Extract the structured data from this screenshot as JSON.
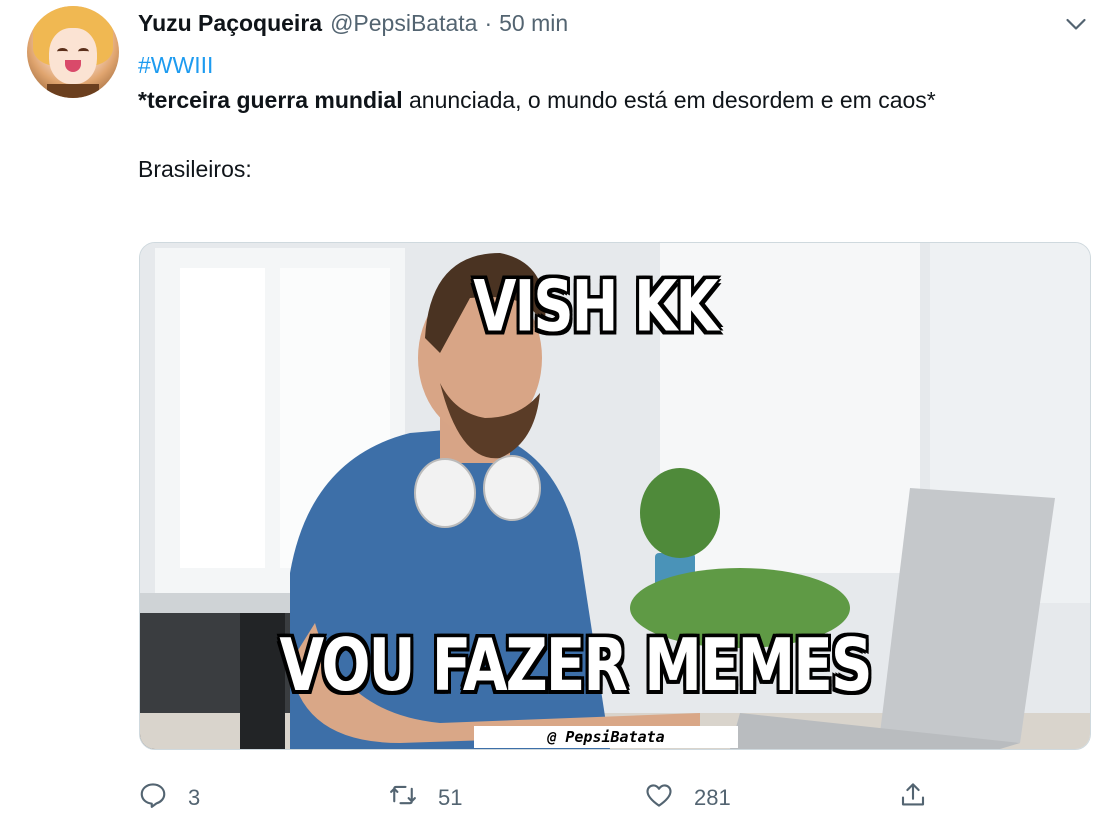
{
  "tweet": {
    "author_name": "Yuzu Paçoqueira",
    "handle": "@PepsiBatata",
    "separator": "·",
    "time": "50 min",
    "hashtag": "#WWIII",
    "text_bold": "*terceira guerra mundial",
    "text_rest": " anunciada, o mundo está em desordem e em caos*",
    "text_line2": "Brasileiros:"
  },
  "media": {
    "caption_top": "VISH KK",
    "caption_bottom": "VOU FAZER MEMES",
    "watermark": "@ PepsiBatata"
  },
  "actions": {
    "reply_count": "3",
    "retweet_count": "51",
    "like_count": "281"
  },
  "colors": {
    "link": "#1d9bf0",
    "secondary_text": "#536471",
    "primary_text": "#0f1419"
  },
  "icons": [
    "chevron-down-icon",
    "reply-icon",
    "retweet-icon",
    "like-icon",
    "share-icon"
  ]
}
